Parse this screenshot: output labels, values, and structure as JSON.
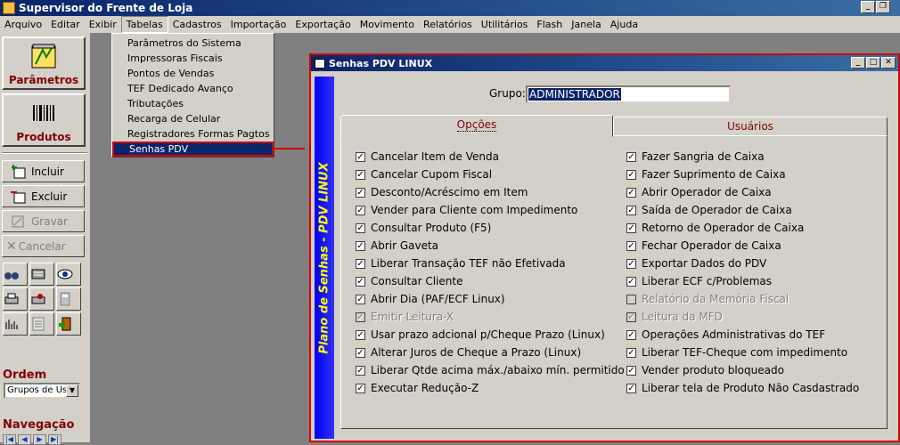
{
  "app": {
    "title": "Supervisor do Frente de Loja"
  },
  "menu": [
    "Arquivo",
    "Editar",
    "Exibir",
    "Tabelas",
    "Cadastros",
    "Importação",
    "Exportação",
    "Movimento",
    "Relatórios",
    "Utilitários",
    "Flash",
    "Janela",
    "Ajuda"
  ],
  "tabelas_menu": [
    "Parâmetros do Sistema",
    "Impressoras Fiscais",
    "Pontos de Vendas",
    "TEF Dedicado Avanço",
    "Tributações",
    "Recarga de Celular",
    "Registradores Formas Pagtos",
    "Senhas PDV"
  ],
  "left": {
    "parametros": "Parâmetros",
    "produtos": "Produtos",
    "incluir": "Incluir",
    "excluir": "Excluir",
    "gravar": "Gravar",
    "cancelar": "Cancelar",
    "ordem_label": "Ordem",
    "ordem_value": "Grupos de Us",
    "navegacao_label": "Navegação"
  },
  "window": {
    "title": "Senhas PDV LINUX",
    "sidebar_text": "Plano de Senhas - PDV LINUX",
    "grupo_label": "Grupo:",
    "grupo_value": "ADMINISTRADOR",
    "tab_opcoes": "Opções",
    "tab_usuarios": "Usuários"
  },
  "options_left": [
    {
      "label": "Cancelar Item de Venda",
      "checked": true,
      "enabled": true
    },
    {
      "label": "Cancelar Cupom Fiscal",
      "checked": true,
      "enabled": true
    },
    {
      "label": "Desconto/Acréscimo em Item",
      "checked": true,
      "enabled": true
    },
    {
      "label": "Vender para Cliente com Impedimento",
      "checked": true,
      "enabled": true
    },
    {
      "label": "Consultar Produto (F5)",
      "checked": true,
      "enabled": true
    },
    {
      "label": "Abrir Gaveta",
      "checked": true,
      "enabled": true
    },
    {
      "label": "Liberar Transação TEF não Efetivada",
      "checked": true,
      "enabled": true
    },
    {
      "label": "Consultar Cliente",
      "checked": true,
      "enabled": true
    },
    {
      "label": "Abrir Dia (PAF/ECF Linux)",
      "checked": true,
      "enabled": true
    },
    {
      "label": "Emitir Leitura-X",
      "checked": true,
      "enabled": false
    },
    {
      "label": "Usar prazo adcional p/Cheque Prazo (Linux)",
      "checked": true,
      "enabled": true
    },
    {
      "label": "Alterar Juros de Cheque a Prazo (Linux)",
      "checked": true,
      "enabled": true
    },
    {
      "label": "Liberar Qtde acima máx./abaixo mín. permitido",
      "checked": true,
      "enabled": true
    },
    {
      "label": "Executar Redução-Z",
      "checked": true,
      "enabled": true
    }
  ],
  "options_right": [
    {
      "label": "Fazer Sangria de Caixa",
      "checked": true,
      "enabled": true
    },
    {
      "label": "Fazer Suprimento de Caixa",
      "checked": true,
      "enabled": true
    },
    {
      "label": "Abrir Operador de Caixa",
      "checked": true,
      "enabled": true
    },
    {
      "label": "Saída de Operador de Caixa",
      "checked": true,
      "enabled": true
    },
    {
      "label": "Retorno de Operador de Caixa",
      "checked": true,
      "enabled": true
    },
    {
      "label": "Fechar Operador de Caixa",
      "checked": true,
      "enabled": true
    },
    {
      "label": "Exportar Dados do PDV",
      "checked": true,
      "enabled": true
    },
    {
      "label": "Liberar ECF c/Problemas",
      "checked": true,
      "enabled": true
    },
    {
      "label": "Relatório da Memória Fiscal",
      "checked": false,
      "enabled": false
    },
    {
      "label": "Leitura da MFD",
      "checked": true,
      "enabled": false
    },
    {
      "label": "Operações Administrativas do TEF",
      "checked": true,
      "enabled": true
    },
    {
      "label": "Liberar TEF-Cheque com impedimento",
      "checked": true,
      "enabled": true
    },
    {
      "label": "Vender produto bloqueado",
      "checked": true,
      "enabled": true
    },
    {
      "label": "Liberar tela de Produto Não Casdastrado",
      "checked": true,
      "enabled": true
    }
  ],
  "colors": {
    "accent_red": "#d00000",
    "title_blue": "#0a246a",
    "label_maroon": "#800000",
    "sidebar_blue": "#0000ee",
    "sidebar_text": "#ffff00"
  }
}
